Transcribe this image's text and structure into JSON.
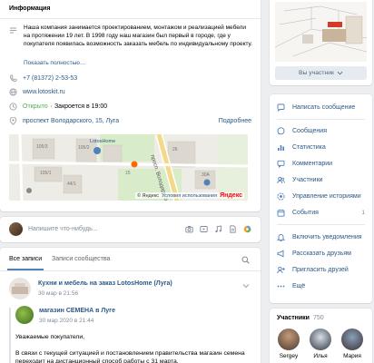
{
  "info": {
    "title": "Информация",
    "description": "Наша компания занимается проектированием, монтажом и реализацией мебели на протяжении 19 лет. В 1998 году наш магазин был первый в городе, где у покупателя появилась возможность заказать мебель по индивидуальному проекту.",
    "show_more": "Показать полностью…",
    "phone": "+7 (81372) 2-53-53",
    "website": "www.lotoskit.ru",
    "hours_status": "Открыто",
    "hours_rest": "· Закроется в 19:00",
    "address": "проспект Володарского, 15, Луга",
    "details": "Подробнее"
  },
  "map": {
    "street_label": "просп. Володарского",
    "poi_label": "LotosHome",
    "house_numbers": [
      "105/3",
      "105/1",
      "105/2",
      "15",
      "30А",
      "44/1",
      "26"
    ],
    "copyright": "© Яндекс",
    "terms": "Условия использования",
    "logo": "Яндекс"
  },
  "composer": {
    "placeholder": "Напишите что-нибудь..."
  },
  "tabs": {
    "all_posts": "Все записи",
    "community_posts": "Записи сообщества"
  },
  "post": {
    "author": "Кухни и мебель на заказ LotosHome (Луга)",
    "time": "30 мар в 21:56",
    "repost_author": "магазин СЕМЕНА в Луге",
    "repost_time": "30 мар 2020 в 21:44",
    "text_1": "Уважаемые покупатели,",
    "text_2": "В связи с текущей ситуацией и постановлением правительства магазин семена переходит на дистанционный способ работы с 31 марта."
  },
  "cover": {
    "button": "Вы участник"
  },
  "menu": {
    "write_message": "Написать сообщение",
    "messages": "Сообщения",
    "stats": "Статистика",
    "comments": "Комментарии",
    "members": "Участники",
    "stories": "Управление историями",
    "events": "События",
    "events_count": "1",
    "notifications": "Включить уведомления",
    "tell_friends": "Рассказать друзьям",
    "invite": "Пригласить друзей",
    "more": "Ещё"
  },
  "members": {
    "title": "Участники",
    "count": "750",
    "names": [
      "Sergey",
      "Илья",
      "Мария"
    ]
  },
  "colors": {
    "link": "#2a5885",
    "accent": "#5181b8",
    "open": "#4bb34b",
    "bg": "#edeef0"
  }
}
